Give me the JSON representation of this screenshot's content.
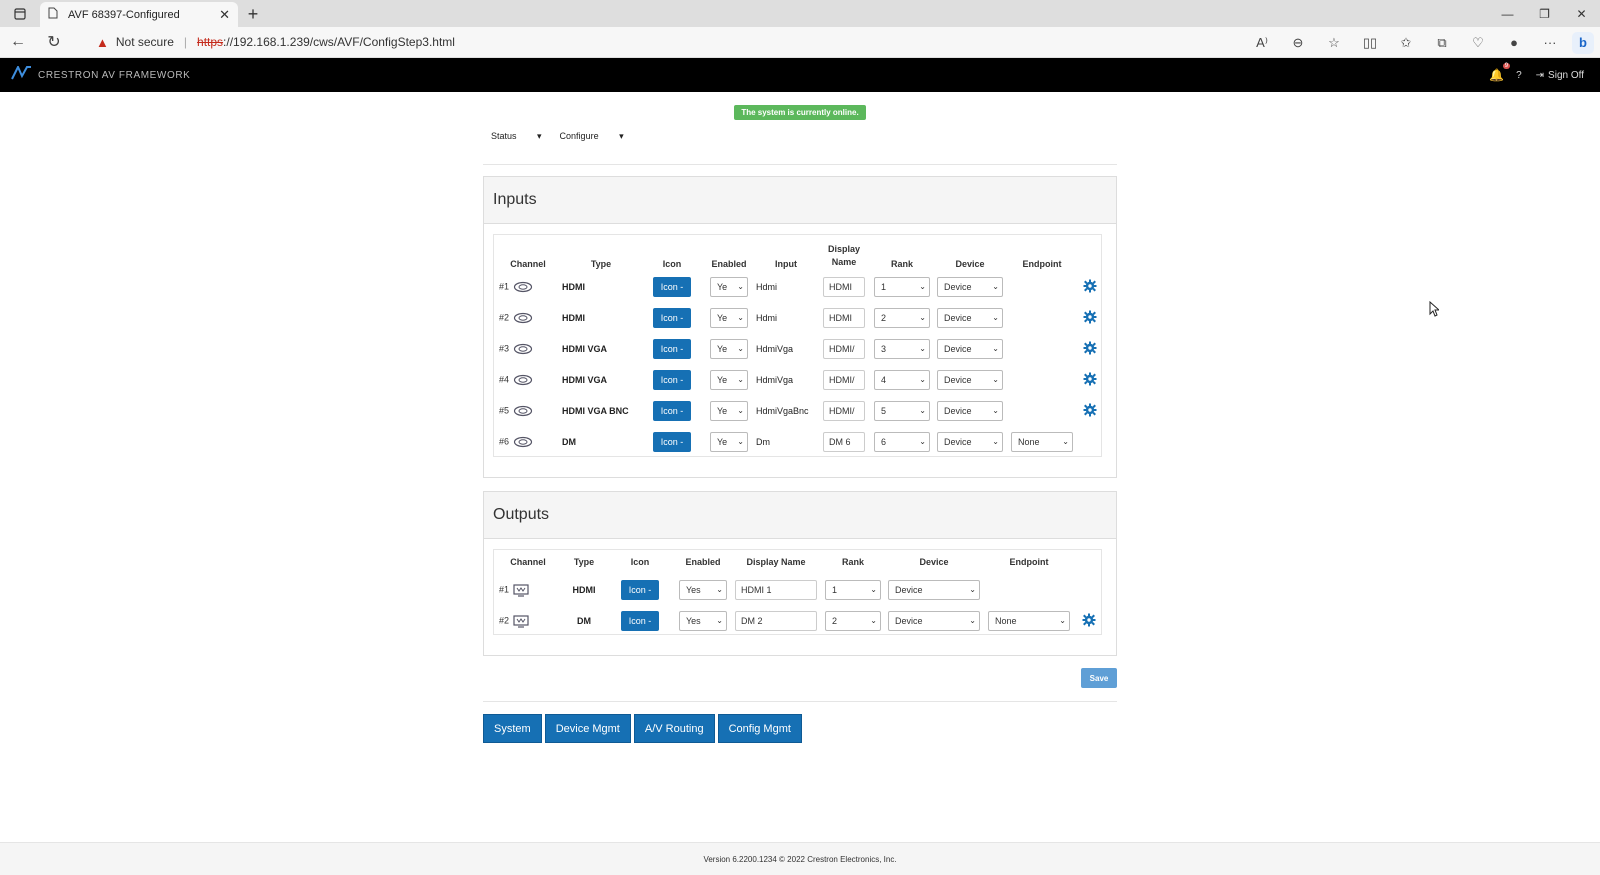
{
  "browser": {
    "tab_title": "AVF 68397-Configured",
    "not_secure": "Not secure",
    "url_scheme": "https",
    "url_rest": "://192.168.1.239/cws/AVF/ConfigStep3.html"
  },
  "app": {
    "brand": "CRESTRON AV FRAMEWORK",
    "notification_count": "9",
    "sign_off": "Sign Off"
  },
  "status_badge": "The system is currently online.",
  "topnav": {
    "status": "Status",
    "configure": "Configure"
  },
  "inputs": {
    "title": "Inputs",
    "headers": {
      "channel": "Channel",
      "type": "Type",
      "icon": "Icon",
      "enabled": "Enabled",
      "input": "Input",
      "display_name_1": "Display",
      "display_name_2": "Name",
      "rank": "Rank",
      "device": "Device",
      "endpoint": "Endpoint"
    },
    "rows": [
      {
        "channel": "#1",
        "type": "HDMI",
        "icon": "Icon -",
        "enabled": "Ye",
        "input": "Hdmi",
        "display": "HDMI",
        "rank": "1",
        "device": "Device",
        "endpoint": ""
      },
      {
        "channel": "#2",
        "type": "HDMI",
        "icon": "Icon -",
        "enabled": "Ye",
        "input": "Hdmi",
        "display": "HDMI",
        "rank": "2",
        "device": "Device",
        "endpoint": ""
      },
      {
        "channel": "#3",
        "type": "HDMI VGA",
        "icon": "Icon -",
        "enabled": "Ye",
        "input": "HdmiVga",
        "display": "HDMI/",
        "rank": "3",
        "device": "Device",
        "endpoint": ""
      },
      {
        "channel": "#4",
        "type": "HDMI VGA",
        "icon": "Icon -",
        "enabled": "Ye",
        "input": "HdmiVga",
        "display": "HDMI/",
        "rank": "4",
        "device": "Device",
        "endpoint": ""
      },
      {
        "channel": "#5",
        "type": "HDMI VGA BNC",
        "icon": "Icon -",
        "enabled": "Ye",
        "input": "HdmiVgaBnc",
        "display": "HDMI/",
        "rank": "5",
        "device": "Device",
        "endpoint": ""
      },
      {
        "channel": "#6",
        "type": "DM",
        "icon": "Icon -",
        "enabled": "Ye",
        "input": "Dm",
        "display": "DM 6",
        "rank": "6",
        "device": "Device",
        "endpoint": "None"
      }
    ]
  },
  "outputs": {
    "title": "Outputs",
    "headers": {
      "channel": "Channel",
      "type": "Type",
      "icon": "Icon",
      "enabled": "Enabled",
      "display_name": "Display Name",
      "rank": "Rank",
      "device": "Device",
      "endpoint": "Endpoint"
    },
    "rows": [
      {
        "channel": "#1",
        "type": "HDMI",
        "icon": "Icon -",
        "enabled": "Yes",
        "display": "HDMI 1",
        "rank": "1",
        "device": "Device",
        "endpoint": ""
      },
      {
        "channel": "#2",
        "type": "DM",
        "icon": "Icon -",
        "enabled": "Yes",
        "display": "DM 2",
        "rank": "2",
        "device": "Device",
        "endpoint": "None"
      }
    ]
  },
  "save_label": "Save",
  "bottom_nav": [
    "System",
    "Device Mgmt",
    "A/V Routing",
    "Config Mgmt"
  ],
  "footer": "Version 6.2200.1234   © 2022 Crestron Electronics, Inc.",
  "colors": {
    "primary": "#1670b4",
    "online": "#5cb85c",
    "header_bg": "#000000"
  }
}
